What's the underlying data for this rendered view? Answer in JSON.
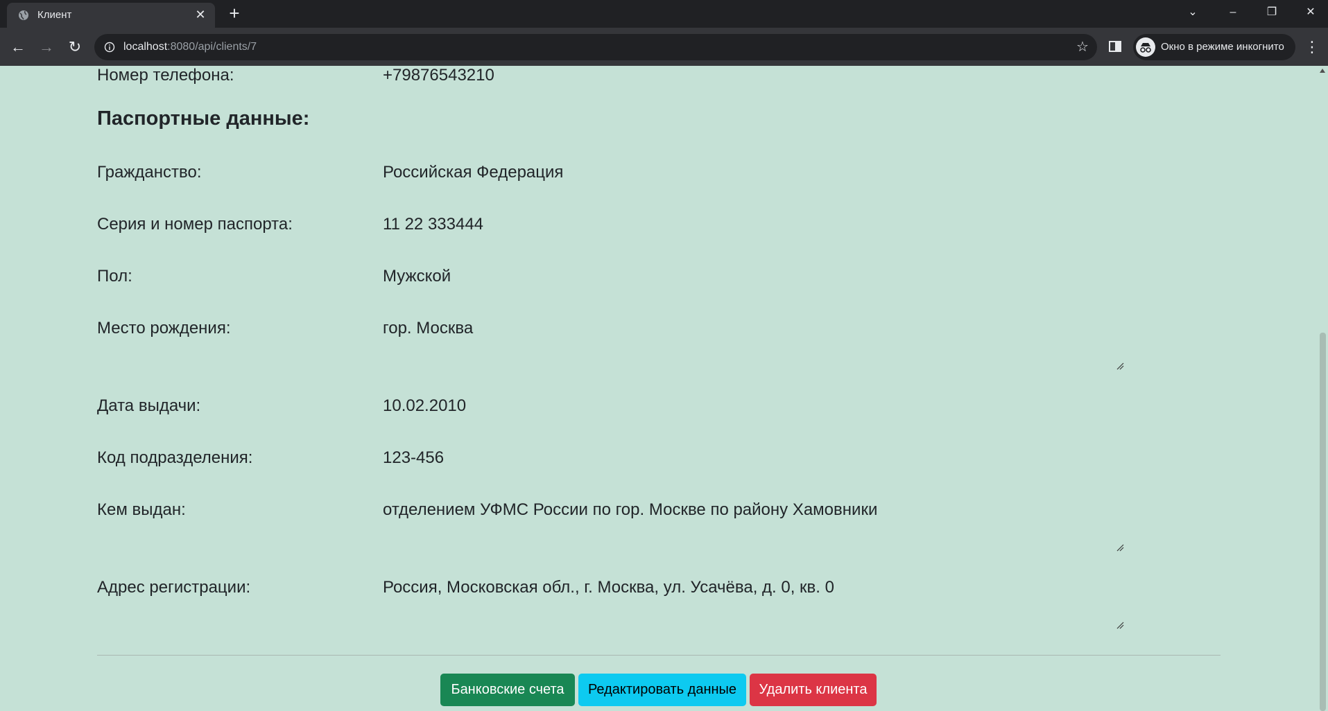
{
  "browser": {
    "tab_title": "Клиент",
    "url_host": "localhost",
    "url_rest": ":8080/api/clients/7",
    "incognito_label": "Окно в режиме инкогнито"
  },
  "client": {
    "phone_label": "Номер телефона:",
    "phone_value": "+79876543210",
    "passport_heading": "Паспортные данные:",
    "fields": [
      {
        "label": "Гражданство:",
        "value": "Российская Федерация"
      },
      {
        "label": "Серия и номер паспорта:",
        "value": "11 22 333444"
      },
      {
        "label": "Пол:",
        "value": "Мужской"
      },
      {
        "label": "Место рождения:",
        "value": "гор. Москва"
      },
      {
        "label": "Дата выдачи:",
        "value": "10.02.2010"
      },
      {
        "label": "Код подразделения:",
        "value": "123-456"
      },
      {
        "label": "Кем выдан:",
        "value": "отделением УФМС России по гор. Москве по району Хамовники"
      },
      {
        "label": "Адрес регистрации:",
        "value": "Россия, Московская обл., г. Москва, ул. Усачёва, д. 0, кв. 0"
      }
    ]
  },
  "actions": {
    "accounts_label": "Банковские счета",
    "edit_label": "Редактировать данные",
    "delete_label": "Удалить клиента"
  },
  "colors": {
    "page_bg": "#c5e1d6",
    "success": "#198754",
    "info": "#0dcaf0",
    "danger": "#dc3545"
  }
}
